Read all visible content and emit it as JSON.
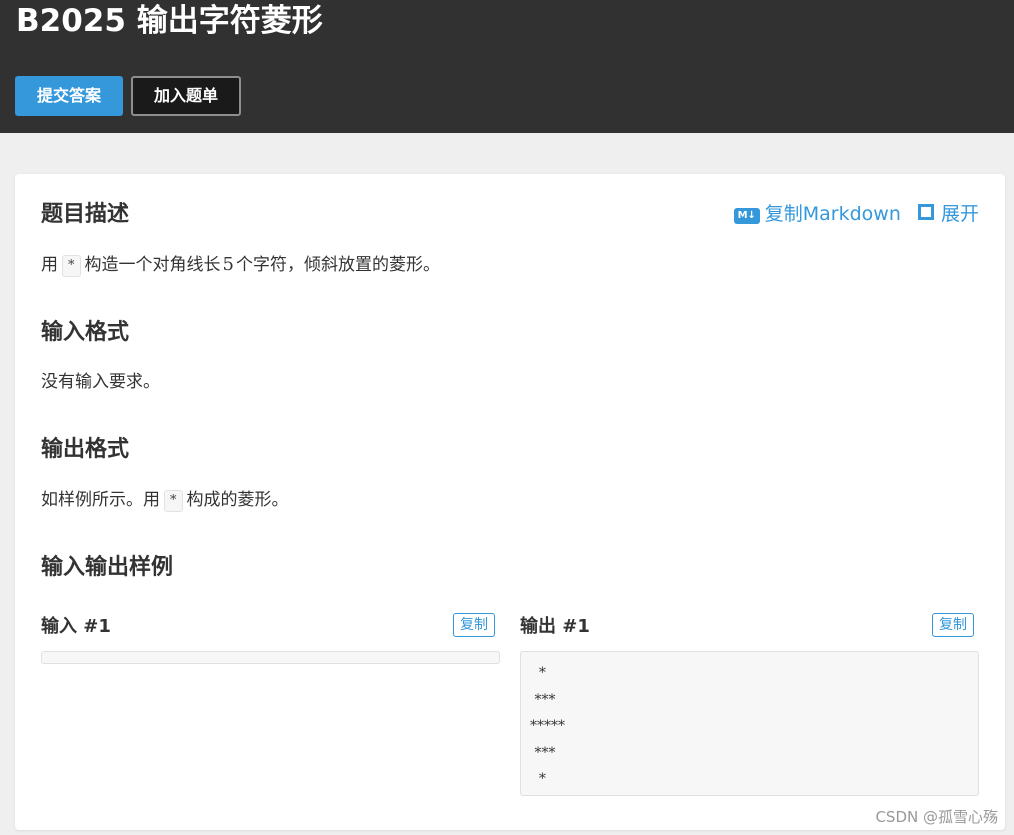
{
  "header": {
    "title": "B2025 输出字符菱形",
    "buttons": {
      "submit_label": "提交答案",
      "add_list_label": "加入题单"
    }
  },
  "actions": {
    "copy_markdown_icon_text": "M↓",
    "copy_markdown_label": "复制Markdown",
    "expand_label": "展开"
  },
  "description": {
    "title": "题目描述",
    "prefix": "用",
    "code": "*",
    "middle": "构造一个对角线长",
    "number": "5",
    "suffix": "个字符，倾斜放置的菱形。"
  },
  "input_format": {
    "title": "输入格式",
    "text": "没有输入要求。"
  },
  "output_format": {
    "title": "输出格式",
    "prefix": "如样例所示。用",
    "code": "*",
    "suffix": "构成的菱形。"
  },
  "samples": {
    "title": "输入输出样例",
    "input_label": "输入 #1",
    "output_label": "输出 #1",
    "copy_label": "复制",
    "input_content": "",
    "output_content": "  *\n ***\n*****\n ***\n  *"
  },
  "watermark": "CSDN @孤雪心殇"
}
